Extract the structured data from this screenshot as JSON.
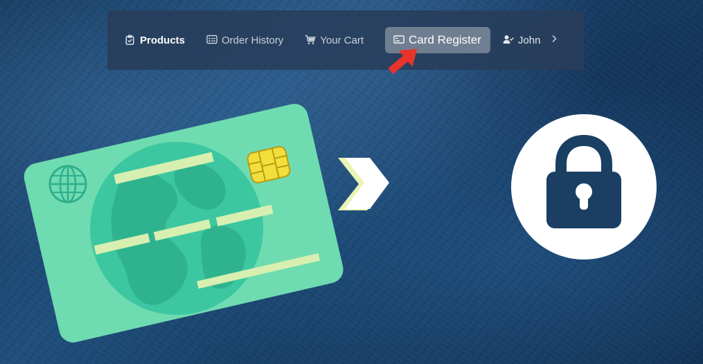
{
  "nav": {
    "items": [
      {
        "label": "Products",
        "icon": "clipboard-check-icon"
      },
      {
        "label": "Order History",
        "icon": "list-card-icon"
      },
      {
        "label": "Your Cart",
        "icon": "cart-icon"
      },
      {
        "label": "Card Register",
        "icon": "credit-card-icon"
      },
      {
        "label": "John",
        "icon": "user-check-icon"
      }
    ],
    "active": "Card Register"
  },
  "colors": {
    "background": "#1f4f7d",
    "navbar": "#283e5a",
    "active_tab": "#6f7e90",
    "card": "#6fdbb0",
    "globe": "#39c49d",
    "chip": "#f2df3c",
    "pointer": "#e8332a",
    "lock": "#1a3f63"
  },
  "illustration": {
    "card_icon": "credit-card-illustration",
    "arrow_icon": "chevron-right-icon",
    "lock_icon": "padlock-icon"
  }
}
